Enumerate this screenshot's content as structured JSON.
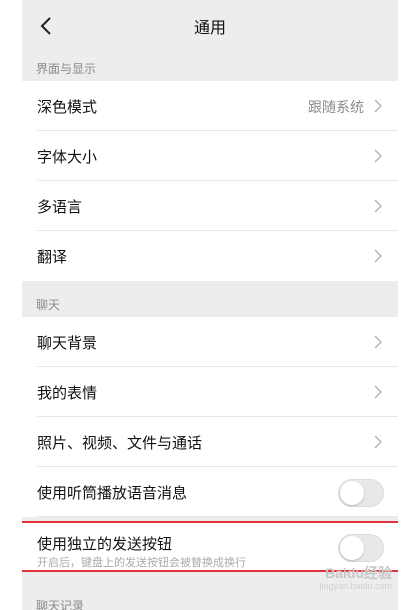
{
  "nav": {
    "title": "通用"
  },
  "sections": {
    "display": {
      "header": "界面与显示"
    },
    "chat": {
      "header": "聊天"
    },
    "history": {
      "header": "聊天记录"
    }
  },
  "rows": {
    "dark_mode": {
      "label": "深色模式",
      "value": "跟随系统"
    },
    "font_size": {
      "label": "字体大小"
    },
    "language": {
      "label": "多语言"
    },
    "translate": {
      "label": "翻译"
    },
    "chat_bg": {
      "label": "聊天背景"
    },
    "stickers": {
      "label": "我的表情"
    },
    "media": {
      "label": "照片、视频、文件与通话"
    },
    "earpiece": {
      "label": "使用听筒播放语音消息",
      "enabled": false
    },
    "send_button": {
      "label": "使用独立的发送按钮",
      "sublabel": "开启后，键盘上的发送按钮会被替换成换行",
      "enabled": false
    }
  },
  "watermark": {
    "brand": "Baidu经验",
    "url": "jingyan.baidu.com"
  },
  "colors": {
    "background": "#ededed",
    "row": "#ffffff",
    "highlight_border": "#e0323a",
    "secondary_text": "#8a8a8a"
  },
  "icons": {
    "back": "chevron-left-icon",
    "row_arrow": "chevron-right-icon"
  }
}
